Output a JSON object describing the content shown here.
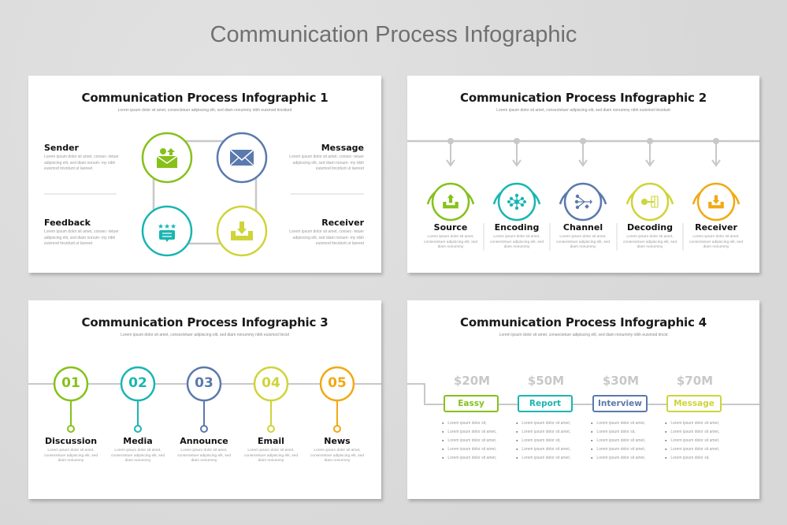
{
  "page": {
    "title": "Communication Process Infographic"
  },
  "colors": {
    "green": "#86c11a",
    "teal": "#1ab5b2",
    "blue": "#5a79ae",
    "lime": "#cfd43a",
    "orange": "#f1a912",
    "line": "#c8c8c8"
  },
  "slide1": {
    "title": "Communication Process Infographic 1",
    "subtitle": "Lorem ipsum dolor sit amet, consectetuer adipiscing elit, sed diam nonummy nibh euismod tincidunt",
    "items": [
      {
        "label": "Sender",
        "text": "Lorem ipsum dolor sit amet, consec- tetuer adipiscing elit, sed diam nonum- my nibh euismod tincidunt ut laoreet",
        "icon": "mail-upload-icon",
        "color": "green"
      },
      {
        "label": "Message",
        "text": "Lorem ipsum dolor sit amet, consec- tetuer adipiscing elit, sed diam nonum- my nibh euismod tincidunt ut laoreet",
        "icon": "envelope-icon",
        "color": "blue"
      },
      {
        "label": "Feedback",
        "text": "Lorem ipsum dolor sit amet, consec- tetuer adipiscing elit, sed diam nonum- my nibh euismod tincidunt ut laoreet",
        "icon": "rating-stars-icon",
        "color": "teal"
      },
      {
        "label": "Receiver",
        "text": "Lorem ipsum dolor sit amet, consec- tetuer adipiscing elit, sed diam nonum- my nibh euismod tincidunt ut laoreet",
        "icon": "inbox-download-icon",
        "color": "lime"
      }
    ]
  },
  "slide2": {
    "title": "Communication Process Infographic 2",
    "subtitle": "Lorem ipsum dolor sit amet, consectetuer adipiscing elit, sed diam nonummy nibh euismod tincidunt",
    "steps": [
      {
        "label": "Source",
        "text": "Lorem ipsum dolor sit amet, consectetuer adipiscing elit, sed diam nonummy",
        "icon": "upload-tray-icon",
        "color": "green"
      },
      {
        "label": "Encoding",
        "text": "Lorem ipsum dolor sit amet, consectetuer adipiscing elit, sed diam nonummy",
        "icon": "network-node-icon",
        "color": "teal"
      },
      {
        "label": "Channel",
        "text": "Lorem ipsum dolor sit amet, consectetuer adipiscing elit, sed diam nonummy",
        "icon": "share-branch-icon",
        "color": "blue"
      },
      {
        "label": "Decoding",
        "text": "Lorem ipsum dolor sit amet, consectetuer adipiscing elit, sed diam nonummy",
        "icon": "key-circuit-icon",
        "color": "lime"
      },
      {
        "label": "Receiver",
        "text": "Lorem ipsum dolor sit amet, consectetuer adipiscing elit, sed diam nonummy",
        "icon": "download-tray-icon",
        "color": "orange"
      }
    ]
  },
  "slide3": {
    "title": "Communication Process Infographic 3",
    "subtitle": "Lorem ipsum dolor sit amet, consectetuer adipiscing elit, sed diam nonummy nibh euismod tincid",
    "steps": [
      {
        "num": "01",
        "label": "Discussion",
        "text": "Lorem ipsum dolor sit amet, consectetuer adipiscing elit, sed diam nonummy",
        "color": "green"
      },
      {
        "num": "02",
        "label": "Media",
        "text": "Lorem ipsum dolor sit amet, consectetuer adipiscing elit, sed diam nonummy",
        "color": "teal"
      },
      {
        "num": "03",
        "label": "Announce",
        "text": "Lorem ipsum dolor sit amet, consectetuer adipiscing elit, sed diam nonummy",
        "color": "blue"
      },
      {
        "num": "04",
        "label": "Email",
        "text": "Lorem ipsum dolor sit amet, consectetuer adipiscing elit, sed diam nonummy",
        "color": "lime"
      },
      {
        "num": "05",
        "label": "News",
        "text": "Lorem ipsum dolor sit amet, consectetuer adipiscing elit, sed diam nonummy",
        "color": "orange"
      }
    ]
  },
  "slide4": {
    "title": "Communication Process Infographic 4",
    "subtitle": "Lorem ipsum dolor sit amet, consectetuer adipiscing elit, sed diam nonummy nibh euismod tincid",
    "columns": [
      {
        "amount": "$20M",
        "label": "Eassy",
        "color": "green",
        "bullets": [
          "Lorem ipsum dolor sit,",
          "Lorem ipsum dolor sit amet,",
          "Lorem ipsum dolor sit amet,",
          "Lorem ipsum dolor sit amet,",
          "Lorem ipsum dolor sit amet,"
        ]
      },
      {
        "amount": "$50M",
        "label": "Report",
        "color": "teal",
        "bullets": [
          "Lorem ipsum dolor sit amet,",
          "Lorem ipsum dolor sit amet,",
          "Lorem ipsum dolor sit,",
          "Lorem ipsum dolor sit amet,",
          "Lorem ipsum dolor sit amet,"
        ]
      },
      {
        "amount": "$30M",
        "label": "Interview",
        "color": "blue",
        "bullets": [
          "Lorem ipsum dolor sit amet,",
          "Lorem ipsum dolor sit,",
          "Lorem ipsum dolor sit amet,",
          "Lorem ipsum dolor sit amet,",
          "Lorem ipsum dolor sit amet,"
        ]
      },
      {
        "amount": "$70M",
        "label": "Message",
        "color": "lime",
        "bullets": [
          "Lorem ipsum dolor sit amet,",
          "Lorem ipsum dolor sit amet,",
          "Lorem ipsum dolor sit amet,",
          "Lorem ipsum dolor sit amet,",
          "Lorem ipsum dolor sit,"
        ]
      }
    ]
  }
}
